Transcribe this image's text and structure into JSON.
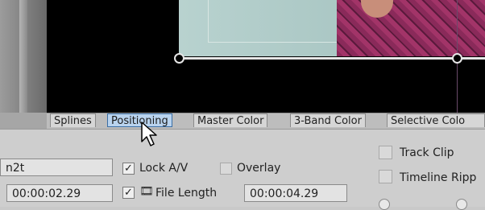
{
  "tabs": [
    {
      "label": "Splines",
      "active": false
    },
    {
      "label": "Positioning",
      "active": true
    },
    {
      "label": "Master Color",
      "active": false
    },
    {
      "label": "3-Band Color",
      "active": false
    },
    {
      "label": "Selective Colo",
      "active": false
    }
  ],
  "panel": {
    "name_field": "n2t",
    "time_field": "00:00:02.29",
    "lock_av": {
      "label": "Lock A/V",
      "checked": true
    },
    "overlay": {
      "label": "Overlay",
      "checked": false
    },
    "file_length": {
      "label": "File Length",
      "checked": true,
      "value": "00:00:04.29"
    },
    "track_clip": {
      "label": "Track Clip",
      "checked": false
    },
    "timeline_ripple": {
      "label": "Timeline Ripp",
      "checked": false
    }
  },
  "colors": {
    "active_tab": "#b9d3ee",
    "active_tab_border": "#3a6ea5"
  },
  "icons": {
    "cursor": "arrow-cursor-icon",
    "film": "film-icon"
  }
}
